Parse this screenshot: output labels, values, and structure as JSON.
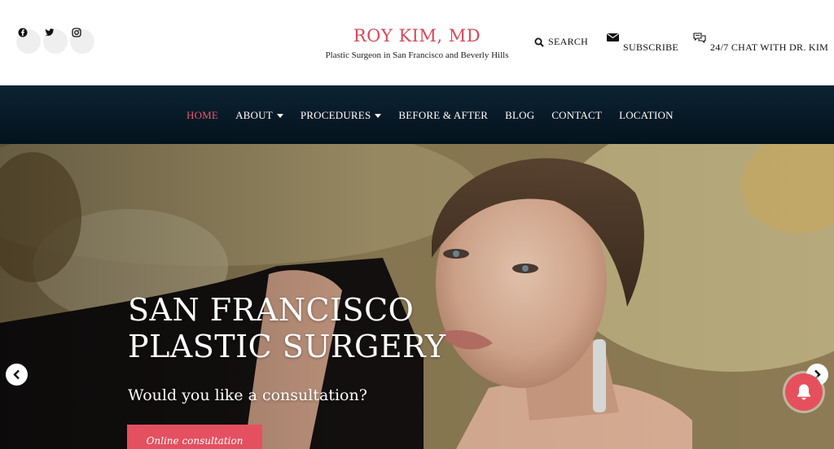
{
  "header": {
    "title": "ROY KIM, MD",
    "subtitle": "Plastic Surgeon in San Francisco and Beverly Hills",
    "social": [
      "facebook-icon",
      "twitter-icon",
      "instagram-icon"
    ],
    "search_label": "SEARCH",
    "subscribe_label": "SUBSCRIBE",
    "chat_label": "24/7 CHAT WITH DR. KIM"
  },
  "nav": {
    "items": [
      {
        "label": "HOME",
        "active": true
      },
      {
        "label": "ABOUT",
        "dropdown": true
      },
      {
        "label": "PROCEDURES",
        "dropdown": true
      },
      {
        "label": "BEFORE & AFTER"
      },
      {
        "label": "BLOG"
      },
      {
        "label": "CONTACT"
      },
      {
        "label": "LOCATION"
      }
    ]
  },
  "hero": {
    "title_line1": "SAN FRANCISCO",
    "title_line2": "PLASTIC SURGERY",
    "question": "Would you like a consultation?",
    "cta_label": "Online consultation"
  },
  "colors": {
    "accent": "#e4505f",
    "navbar": "#0c2333",
    "active_nav": "#e85b6b"
  }
}
